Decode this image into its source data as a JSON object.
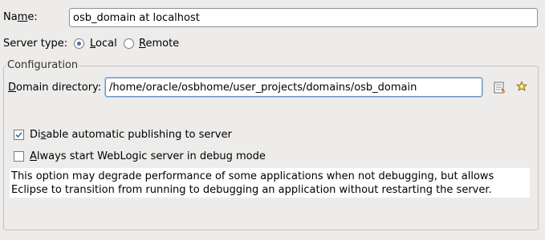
{
  "name": {
    "label_pre": "Na",
    "label_mnemonic": "m",
    "label_post": "e:",
    "value": "osb_domain at localhost"
  },
  "server_type": {
    "label": "Server type:",
    "options": [
      {
        "mnemonic": "L",
        "rest": "ocal",
        "selected": true
      },
      {
        "mnemonic": "R",
        "rest": "emote",
        "selected": false
      }
    ]
  },
  "configuration": {
    "title": "Configuration",
    "domain_directory": {
      "label_mnemonic": "D",
      "label_rest": "omain directory:",
      "value": "/home/oracle/osbhome/user_projects/domains/osb_domain"
    },
    "disable_publishing": {
      "label_pre": "Di",
      "label_mnemonic": "s",
      "label_post": "able automatic publishing to server",
      "checked": true
    },
    "debug_mode": {
      "label_mnemonic": "A",
      "label_rest": "lways start WebLogic server in debug mode",
      "checked": false
    },
    "note": "This option may degrade performance of some applications when not debugging, but allows Eclipse to transition from running to debugging an application without restarting the server."
  },
  "icons": {
    "browse": "browse-folder-icon",
    "variables": "variables-icon"
  },
  "colors": {
    "background": "#edeceb",
    "focus_border": "#6f93c0",
    "radio_dot": "#4a6fa5"
  }
}
